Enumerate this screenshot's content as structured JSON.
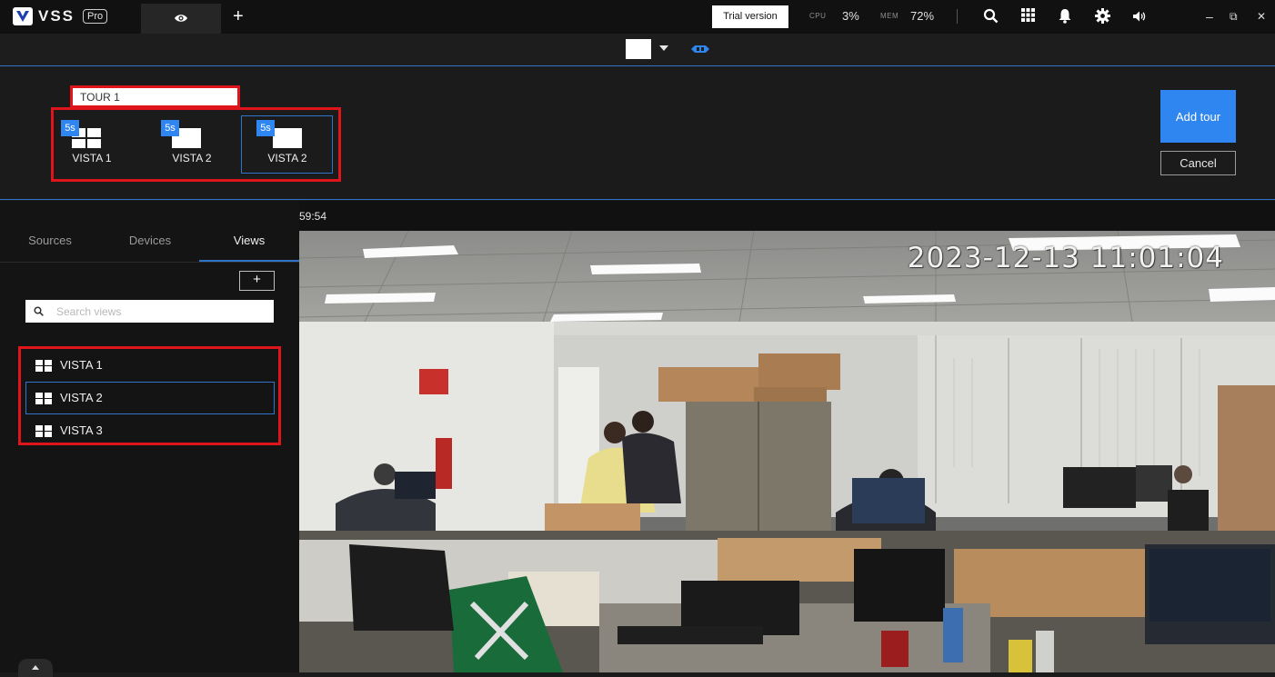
{
  "app": {
    "name": "VSS",
    "edition": "Pro"
  },
  "topbar": {
    "add_tab_label": "+",
    "trial_label": "Trial version",
    "cpu_label": "CPU",
    "cpu_value": "3%",
    "mem_label": "MEM",
    "mem_value": "72%",
    "icons": [
      "search-icon",
      "apps-grid-icon",
      "bell-icon",
      "gear-icon",
      "volume-icon"
    ],
    "window_controls": {
      "minimize": "–",
      "restore": "⧉",
      "close": "✕"
    }
  },
  "tour_editor": {
    "name_value": "TOUR 1",
    "views": [
      {
        "duration": "5s",
        "label": "VISTA 1",
        "layout": "grid-4",
        "selected": false
      },
      {
        "duration": "5s",
        "label": "VISTA 2",
        "layout": "single",
        "selected": false
      },
      {
        "duration": "5s",
        "label": "VISTA 2",
        "layout": "single",
        "selected": true
      }
    ],
    "add_tour_label": "Add tour",
    "cancel_label": "Cancel"
  },
  "sidebar": {
    "tabs": [
      {
        "label": "Sources",
        "active": false
      },
      {
        "label": "Devices",
        "active": false
      },
      {
        "label": "Views",
        "active": true
      }
    ],
    "add_label": "+",
    "search_placeholder": "Search views",
    "views": [
      {
        "label": "VISTA 1",
        "selected": false
      },
      {
        "label": "VISTA 2",
        "selected": true
      },
      {
        "label": "VISTA 3",
        "selected": false
      }
    ]
  },
  "video": {
    "header_time": "59:54",
    "osd_timestamp": "2023-12-13 11:01:04"
  },
  "colors": {
    "accent": "#2f86f0",
    "highlight": "#e0141b",
    "background": "#1b1b1b"
  }
}
